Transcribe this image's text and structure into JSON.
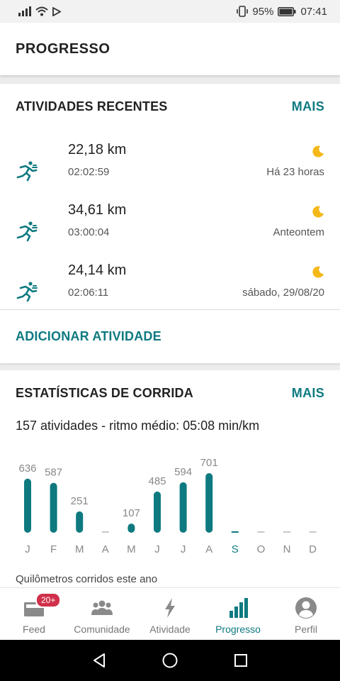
{
  "status_bar": {
    "battery": "95%",
    "time": "07:41"
  },
  "header": {
    "title": "PROGRESSO"
  },
  "recent": {
    "title": "ATIVIDADES RECENTES",
    "more": "MAIS",
    "activities": [
      {
        "distance": "22,18 km",
        "duration": "02:02:59",
        "when": "Há 23 horas",
        "icon": "running-icon",
        "time_of_day_icon": "moon-icon"
      },
      {
        "distance": "34,61 km",
        "duration": "03:00:04",
        "when": "Anteontem",
        "icon": "running-icon",
        "time_of_day_icon": "moon-icon"
      },
      {
        "distance": "24,14 km",
        "duration": "02:06:11",
        "when": "sábado, 29/08/20",
        "icon": "running-icon",
        "time_of_day_icon": "moon-icon"
      }
    ],
    "add_activity": "ADICIONAR ATIVIDADE"
  },
  "stats": {
    "title": "ESTATÍSTICAS DE CORRIDA",
    "more": "MAIS",
    "summary": "157 atividades - ritmo médio: 05:08 min/km",
    "caption": "Quilômetros corridos este ano"
  },
  "chart_data": {
    "type": "bar",
    "categories": [
      "J",
      "F",
      "M",
      "A",
      "M",
      "J",
      "J",
      "A",
      "S",
      "O",
      "N",
      "D"
    ],
    "values": [
      636,
      587,
      251,
      0,
      107,
      485,
      594,
      701,
      0,
      0,
      0,
      0
    ],
    "value_labels": [
      "636",
      "587",
      "251",
      "",
      "107",
      "485",
      "594",
      "701",
      "",
      "",
      "",
      ""
    ],
    "current_index": 8,
    "bar_color": "#0e7a80",
    "empty_color": "#c8c8c8",
    "ylim": [
      0,
      701
    ]
  },
  "bottom_nav": {
    "items": [
      {
        "label": "Feed",
        "icon": "feed-icon",
        "badge": "20+",
        "active": false
      },
      {
        "label": "Comunidade",
        "icon": "community-icon",
        "active": false
      },
      {
        "label": "Atividade",
        "icon": "lightning-icon",
        "active": false
      },
      {
        "label": "Progresso",
        "icon": "bar-chart-icon",
        "active": true
      },
      {
        "label": "Perfil",
        "icon": "profile-icon",
        "active": false
      }
    ]
  },
  "colors": {
    "accent": "#0e7a80",
    "badge": "#d0304a",
    "moon": "#f5b819"
  }
}
